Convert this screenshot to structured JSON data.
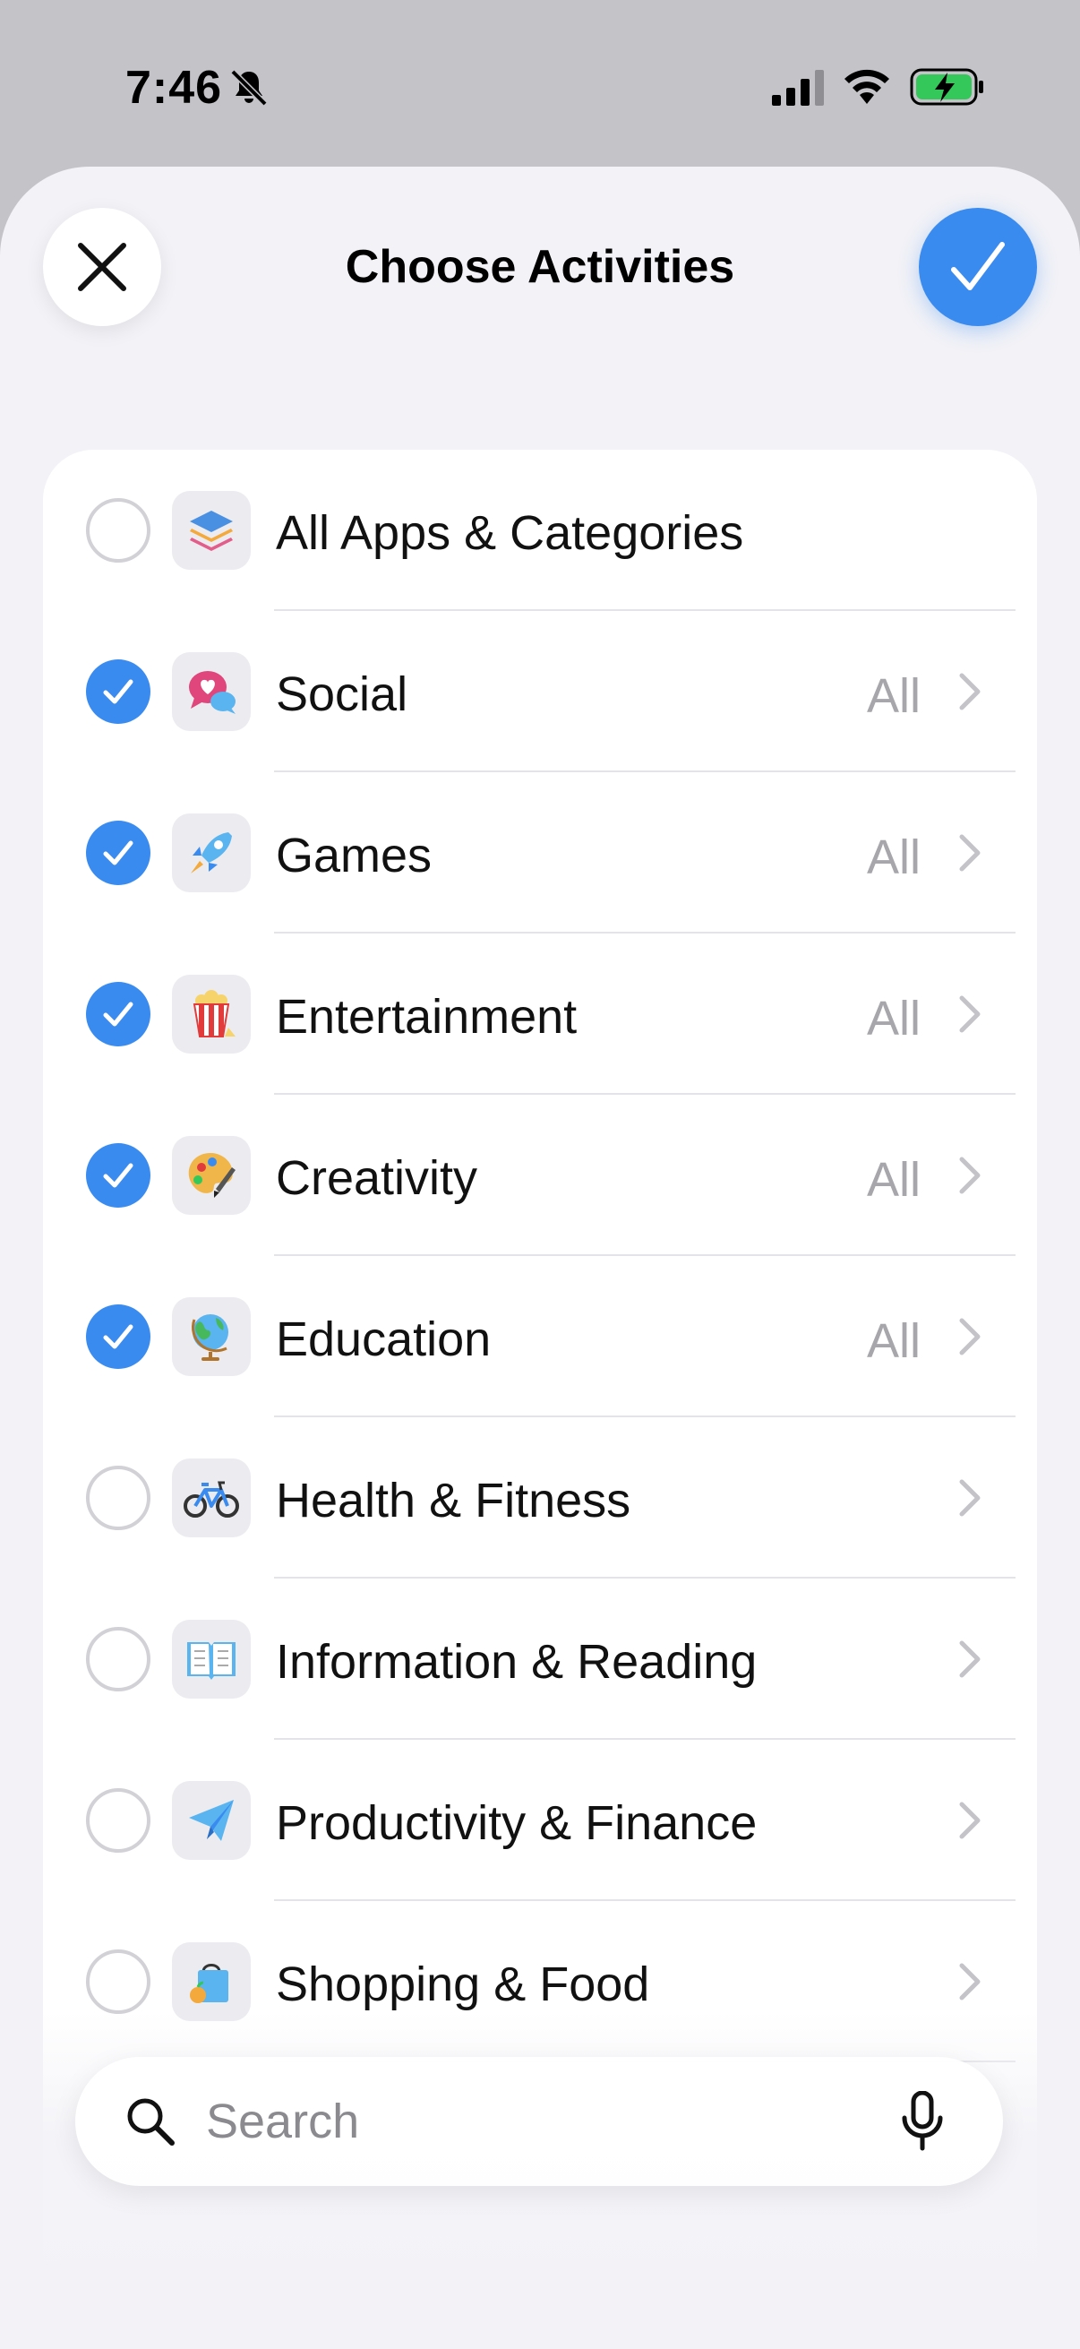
{
  "status_bar": {
    "time": "7:46"
  },
  "header": {
    "title": "Choose Activities"
  },
  "rows": [
    {
      "label": "All Apps & Categories",
      "value": "",
      "checked": false,
      "icon": "stack-icon",
      "chevron": false
    },
    {
      "label": "Social",
      "value": "All",
      "checked": true,
      "icon": "chat-heart-icon",
      "chevron": true
    },
    {
      "label": "Games",
      "value": "All",
      "checked": true,
      "icon": "rocket-icon",
      "chevron": true
    },
    {
      "label": "Entertainment",
      "value": "All",
      "checked": true,
      "icon": "popcorn-icon",
      "chevron": true
    },
    {
      "label": "Creativity",
      "value": "All",
      "checked": true,
      "icon": "palette-icon",
      "chevron": true
    },
    {
      "label": "Education",
      "value": "All",
      "checked": true,
      "icon": "globe-icon",
      "chevron": true
    },
    {
      "label": "Health & Fitness",
      "value": "",
      "checked": false,
      "icon": "bicycle-icon",
      "chevron": true
    },
    {
      "label": "Information & Reading",
      "value": "",
      "checked": false,
      "icon": "book-icon",
      "chevron": true
    },
    {
      "label": "Productivity & Finance",
      "value": "",
      "checked": false,
      "icon": "paper-plane-icon",
      "chevron": true
    },
    {
      "label": "Shopping & Food",
      "value": "",
      "checked": false,
      "icon": "shopping-bag-icon",
      "chevron": true
    }
  ],
  "search": {
    "placeholder": "Search"
  },
  "colors": {
    "accent": "#3a8bf0",
    "background": "#f2f2f7"
  }
}
